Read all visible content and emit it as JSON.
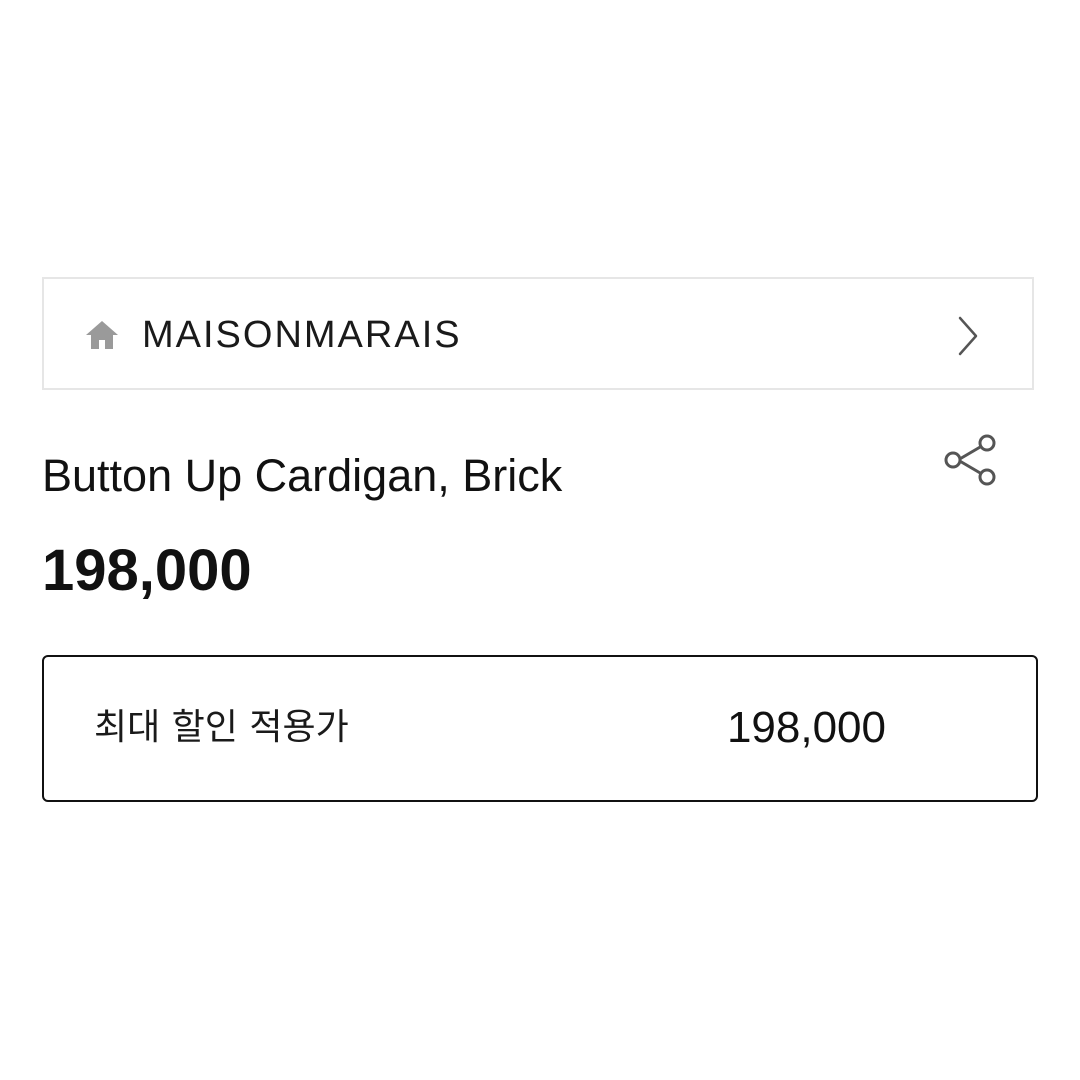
{
  "brand": {
    "name": "MAISONMARAIS",
    "home_icon": "home-icon",
    "arrow_icon": "chevron-right-icon"
  },
  "product": {
    "title": "Button Up Cardigan, Brick",
    "price": "198,000",
    "share_icon": "share-icon"
  },
  "discount": {
    "label": "최대 할인 적용가",
    "value": "198,000"
  },
  "colors": {
    "text": "#111111",
    "icon_gray": "#9a9a9a",
    "border_light": "#e6e6e6",
    "border_dark": "#111111"
  }
}
